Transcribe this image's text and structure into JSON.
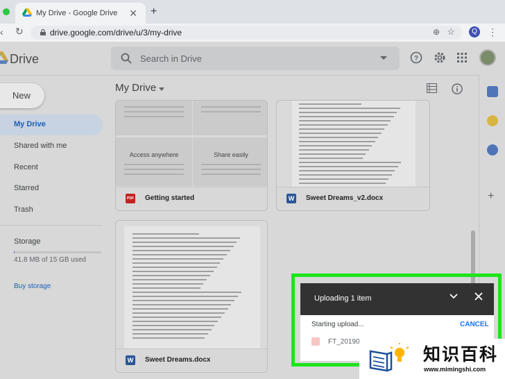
{
  "browser": {
    "tab_title": "My Drive - Google Drive",
    "tab_close": "✕",
    "new_tab": "+",
    "url": "drive.google.com/drive/u/3/my-drive",
    "profile_initial": "Q"
  },
  "header": {
    "app_name": "Drive",
    "search_placeholder": "Search in Drive"
  },
  "sidebar": {
    "new_button": "New",
    "items": [
      {
        "label": "My Drive"
      },
      {
        "label": "Shared with me"
      },
      {
        "label": "Recent"
      },
      {
        "label": "Starred"
      },
      {
        "label": "Trash"
      }
    ],
    "storage_label": "Storage",
    "storage_used": "41.8 MB of 15 GB used",
    "storage_fraction": 0.003,
    "buy_storage": "Buy storage"
  },
  "main": {
    "title": "My Drive",
    "files": [
      {
        "name": "Getting started",
        "type": "PDF"
      },
      {
        "name": "Sweet Dreams_v2.docx",
        "type": "W"
      },
      {
        "name": "Sweet Dreams.docx",
        "type": "W"
      }
    ],
    "getting_started_tiles": [
      "Access anywhere",
      "Share easily"
    ]
  },
  "upload": {
    "title": "Uploading 1 item",
    "status": "Starting upload...",
    "cancel": "CANCEL",
    "file_name": "FT_20190"
  },
  "watermark": {
    "chinese": "知识百科",
    "url": "www.mimingshi.com"
  },
  "colors": {
    "accent": "#1a73e8",
    "highlight": "#1ee31e"
  }
}
